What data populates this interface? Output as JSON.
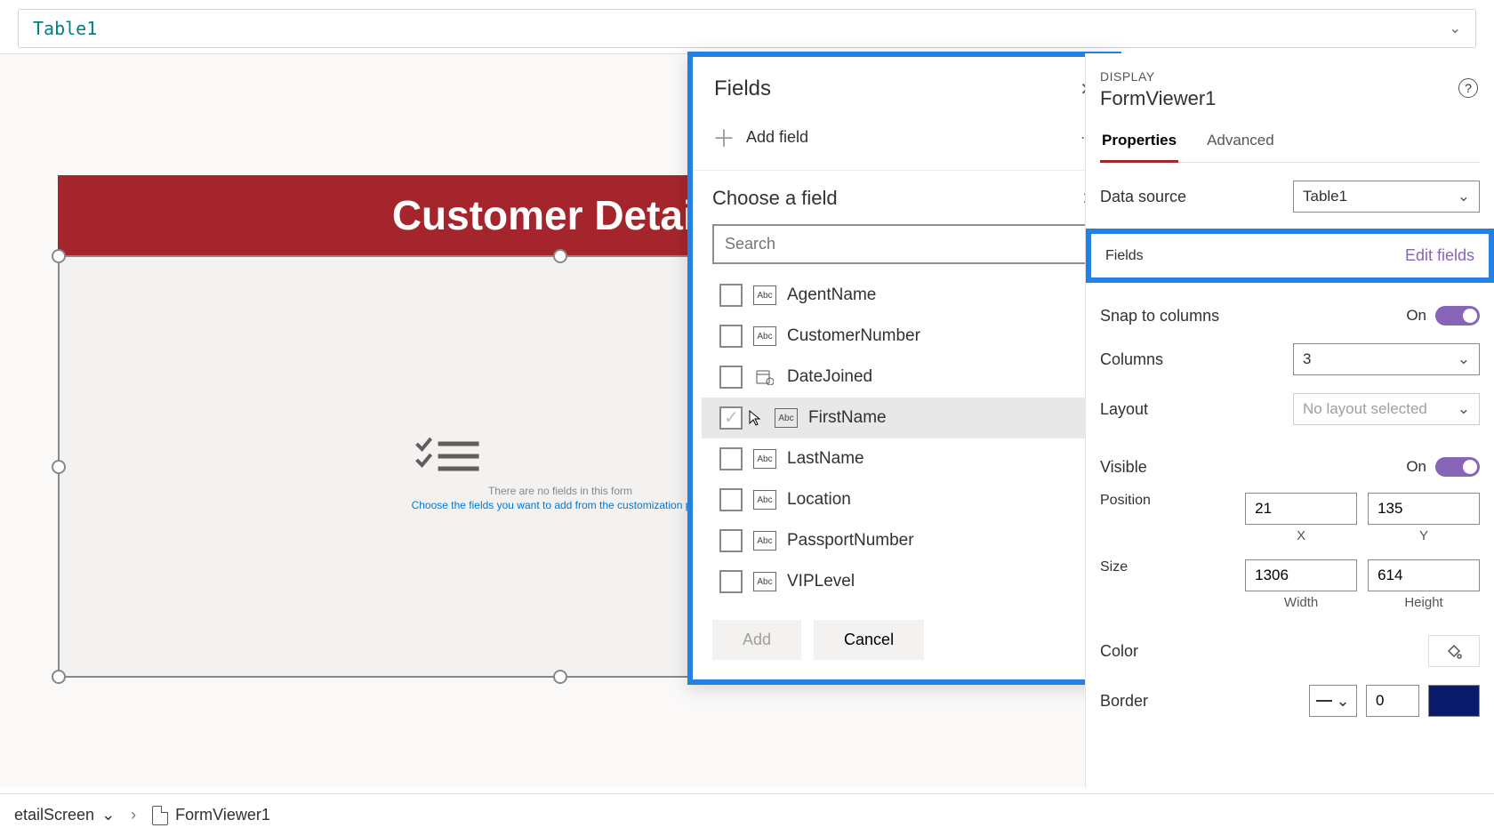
{
  "formula_bar": {
    "text": "Table1"
  },
  "canvas": {
    "header_title": "Customer Details",
    "empty_line1": "There are no fields in this form",
    "empty_line2": "Choose the fields you want to add from the customization pane"
  },
  "fields_panel": {
    "title": "Fields",
    "add_field": "Add field",
    "choose_title": "Choose a field",
    "search_placeholder": "Search",
    "items": [
      {
        "name": "AgentName",
        "type": "Abc",
        "hover": false
      },
      {
        "name": "CustomerNumber",
        "type": "Abc",
        "hover": false
      },
      {
        "name": "DateJoined",
        "type": "date",
        "hover": false
      },
      {
        "name": "FirstName",
        "type": "Abc",
        "hover": true
      },
      {
        "name": "LastName",
        "type": "Abc",
        "hover": false
      },
      {
        "name": "Location",
        "type": "Abc",
        "hover": false
      },
      {
        "name": "PassportNumber",
        "type": "Abc",
        "hover": false
      },
      {
        "name": "VIPLevel",
        "type": "Abc",
        "hover": false
      }
    ],
    "add_btn": "Add",
    "cancel_btn": "Cancel"
  },
  "props": {
    "display_label": "DISPLAY",
    "control_name": "FormViewer1",
    "tabs": {
      "properties": "Properties",
      "advanced": "Advanced"
    },
    "data_source": {
      "label": "Data source",
      "value": "Table1"
    },
    "fields_row": {
      "label": "Fields",
      "action": "Edit fields"
    },
    "snap": {
      "label": "Snap to columns",
      "state": "On"
    },
    "columns": {
      "label": "Columns",
      "value": "3"
    },
    "layout": {
      "label": "Layout",
      "value": "No layout selected"
    },
    "visible": {
      "label": "Visible",
      "state": "On"
    },
    "position": {
      "label": "Position",
      "x": "21",
      "y": "135",
      "xl": "X",
      "yl": "Y"
    },
    "size": {
      "label": "Size",
      "w": "1306",
      "h": "614",
      "wl": "Width",
      "hl": "Height"
    },
    "color": {
      "label": "Color"
    },
    "border": {
      "label": "Border",
      "width": "0"
    }
  },
  "breadcrumb": {
    "screen": "etailScreen",
    "control": "FormViewer1"
  }
}
